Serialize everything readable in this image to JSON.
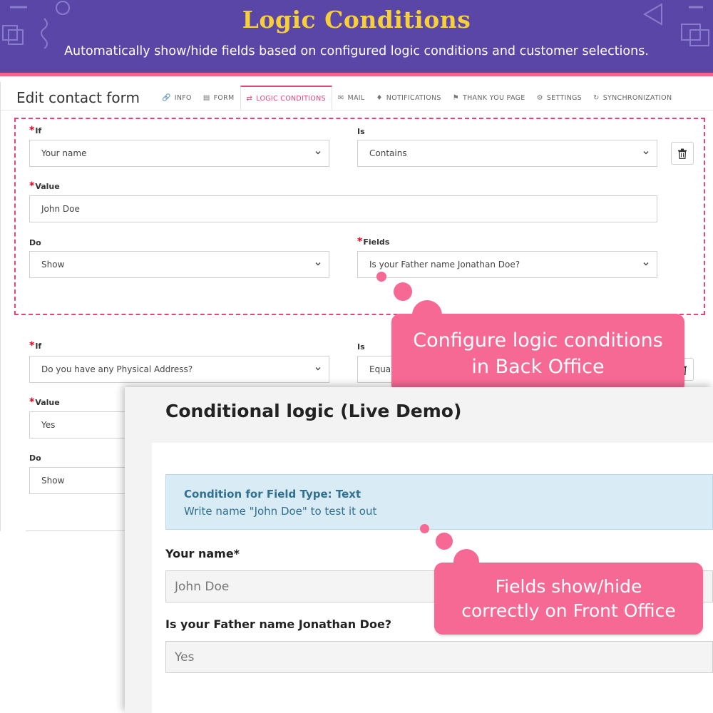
{
  "banner": {
    "title": "Logic Conditions",
    "subtitle": "Automatically show/hide fields based on configured logic conditions and customer selections.",
    "colors": {
      "background": "#5a46a6",
      "title": "#f7cf3b",
      "accent": "#f0648f"
    }
  },
  "back_office": {
    "title": "Edit contact form",
    "tabs": [
      {
        "label": "INFO",
        "icon": "link-icon"
      },
      {
        "label": "FORM",
        "icon": "form-icon"
      },
      {
        "label": "LOGIC CONDITIONS",
        "icon": "shuffle-icon",
        "active": true
      },
      {
        "label": "MAIL",
        "icon": "mail-icon"
      },
      {
        "label": "NOTIFICATIONS",
        "icon": "bell-icon"
      },
      {
        "label": "THANK YOU PAGE",
        "icon": "flag-icon"
      },
      {
        "label": "SETTINGS",
        "icon": "gear-icon"
      },
      {
        "label": "SYNCHRONIZATION",
        "icon": "refresh-icon"
      }
    ],
    "condition1": {
      "if_label": "If",
      "if_value": "Your name",
      "is_label": "Is",
      "is_value": "Contains",
      "value_label": "Value",
      "value_value": "John Doe",
      "do_label": "Do",
      "do_value": "Show",
      "fields_label": "Fields",
      "fields_value": "Is your Father name Jonathan Doe?"
    },
    "condition2": {
      "if_label": "If",
      "if_value": "Do you have any Physical Address?",
      "is_label": "Is",
      "is_value": "Equal",
      "value_label": "Value",
      "value_value": "Yes",
      "do_label": "Do",
      "do_value": "Show"
    },
    "required_mark": "*",
    "accent_color": "#e0457b"
  },
  "callouts": {
    "back": "Configure logic conditions in Back Office",
    "front": "Fields show/hide correctly on Front Office",
    "color": "#f66994"
  },
  "front_office": {
    "title": "Conditional logic (Live Demo)",
    "alert_heading": "Condition for Field Type: Text",
    "alert_text": "Write name \"John Doe\" to test it out",
    "field1_label": "Your name*",
    "field1_value": "John Doe",
    "field2_label": "Is your Father name Jonathan Doe?",
    "field2_value": "Yes"
  }
}
